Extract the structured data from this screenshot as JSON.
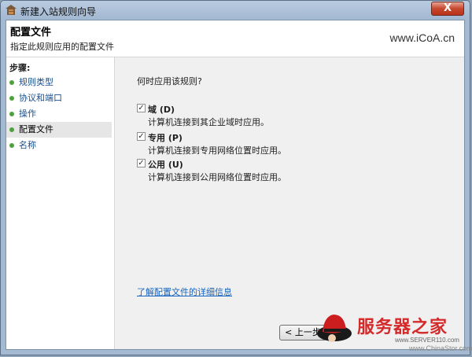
{
  "window": {
    "title": "新建入站规则向导",
    "close_label": "X"
  },
  "header": {
    "title": "配置文件",
    "subtitle": "指定此规则应用的配置文件",
    "site": "www.iCoA.cn"
  },
  "sidebar": {
    "steps_label": "步骤:",
    "items": [
      {
        "label": "规则类型"
      },
      {
        "label": "协议和端口"
      },
      {
        "label": "操作"
      },
      {
        "label": "配置文件"
      },
      {
        "label": "名称"
      }
    ]
  },
  "content": {
    "question": "何时应用该规则?",
    "options": [
      {
        "label": "域 (D)",
        "description": "计算机连接到其企业域时应用。",
        "checked": true
      },
      {
        "label": "专用 (P)",
        "description": "计算机连接到专用网络位置时应用。",
        "checked": true
      },
      {
        "label": "公用 (U)",
        "description": "计算机连接到公用网络位置时应用。",
        "checked": true
      }
    ],
    "help_link": "了解配置文件的详细信息",
    "back_button": "< 上一步"
  },
  "watermark": {
    "name": "服务器之家",
    "url1": "www.SERVER110.com",
    "url2": "www.ChinaStor.com"
  },
  "colors": {
    "link": "#1565c0",
    "step_dot": "#4da23d",
    "logo_red": "#d42a2a"
  }
}
